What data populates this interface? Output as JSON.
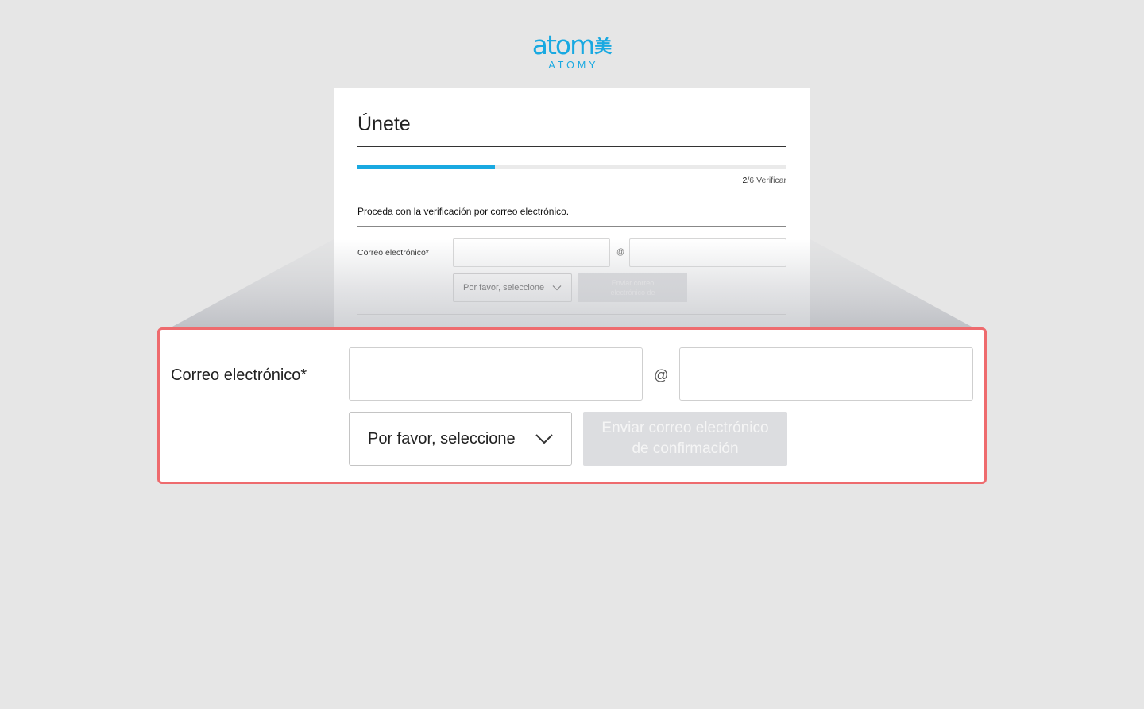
{
  "brand": {
    "logo_word": "atom",
    "logo_hanzi": "美",
    "logo_sub": "ATOMY",
    "color": "#19a9e1"
  },
  "card": {
    "title": "Únete",
    "progress": {
      "current": "2",
      "total_suffix": "/6 Verificar",
      "fraction": 0.32
    },
    "description": "Proceda con la verificación por correo electrónico.",
    "email_label": "Correo electrónico*",
    "at_symbol": "@",
    "domain_select": "Por favor, seleccione",
    "send_button": "Enviar correo electrónico de"
  },
  "zoom": {
    "email_label": "Correo electrónico*",
    "email_user_value": "",
    "email_domain_value": "",
    "at_symbol": "@",
    "domain_select": "Por favor, seleccione",
    "send_button": "Enviar correo electrónico de confirmación",
    "highlight_color": "#ee6b6e"
  },
  "icons": {
    "chevron": "chevron-down-icon"
  }
}
